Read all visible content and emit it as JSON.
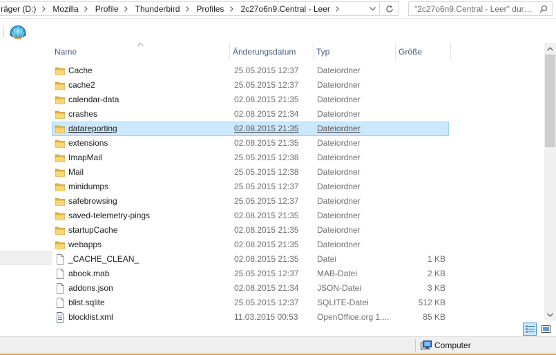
{
  "address_bar": {
    "crumbs": [
      "räger (D:)",
      "Mozilla",
      "Profile",
      "Thunderbird",
      "Profiles",
      "2c27o6n9.Central - Leer"
    ]
  },
  "search": {
    "placeholder": "\"2c27o6n9.Central - Leer\" dur…"
  },
  "columns": {
    "name": "Name",
    "date": "Änderungsdatum",
    "type": "Typ",
    "size": "Größe"
  },
  "files": [
    {
      "name": "Cache",
      "date": "25.05.2015 12:37",
      "type": "Dateiordner",
      "size": "",
      "icon": "folder-icon"
    },
    {
      "name": "cache2",
      "date": "25.05.2015 12:37",
      "type": "Dateiordner",
      "size": "",
      "icon": "folder-icon"
    },
    {
      "name": "calendar-data",
      "date": "02.08.2015 21:35",
      "type": "Dateiordner",
      "size": "",
      "icon": "folder-icon"
    },
    {
      "name": "crashes",
      "date": "02.08.2015 21:34",
      "type": "Dateiordner",
      "size": "",
      "icon": "folder-icon"
    },
    {
      "name": "datareporting",
      "date": "02.08.2015 21:35",
      "type": "Dateiordner",
      "size": "",
      "icon": "folder-icon",
      "selected": true
    },
    {
      "name": "extensions",
      "date": "02.08.2015 21:35",
      "type": "Dateiordner",
      "size": "",
      "icon": "folder-icon"
    },
    {
      "name": "ImapMail",
      "date": "25.05.2015 12:38",
      "type": "Dateiordner",
      "size": "",
      "icon": "folder-icon"
    },
    {
      "name": "Mail",
      "date": "25.05.2015 12:38",
      "type": "Dateiordner",
      "size": "",
      "icon": "folder-icon"
    },
    {
      "name": "minidumps",
      "date": "25.05.2015 12:37",
      "type": "Dateiordner",
      "size": "",
      "icon": "folder-icon"
    },
    {
      "name": "safebrowsing",
      "date": "25.05.2015 12:37",
      "type": "Dateiordner",
      "size": "",
      "icon": "folder-icon"
    },
    {
      "name": "saved-telemetry-pings",
      "date": "02.08.2015 21:35",
      "type": "Dateiordner",
      "size": "",
      "icon": "folder-icon"
    },
    {
      "name": "startupCache",
      "date": "02.08.2015 21:35",
      "type": "Dateiordner",
      "size": "",
      "icon": "folder-icon"
    },
    {
      "name": "webapps",
      "date": "02.08.2015 21:35",
      "type": "Dateiordner",
      "size": "",
      "icon": "folder-icon"
    },
    {
      "name": "_CACHE_CLEAN_",
      "date": "02.08.2015 21:35",
      "type": "Datei",
      "size": "1 KB",
      "icon": "file-icon"
    },
    {
      "name": "abook.mab",
      "date": "25.05.2015 12:37",
      "type": "MAB-Datei",
      "size": "2 KB",
      "icon": "file-icon"
    },
    {
      "name": "addons.json",
      "date": "02.08.2015 21:34",
      "type": "JSON-Datei",
      "size": "3 KB",
      "icon": "file-icon"
    },
    {
      "name": "blist.sqlite",
      "date": "25.05.2015 12:37",
      "type": "SQLITE-Datei",
      "size": "512 KB",
      "icon": "file-icon"
    },
    {
      "name": "blocklist.xml",
      "date": "11.03.2015 00:53",
      "type": "OpenOffice.org 1....",
      "size": "85 KB",
      "icon": "xml-file-icon"
    }
  ],
  "status_bar": {
    "location": "Computer"
  },
  "colors": {
    "selection_bg": "#cce8ff",
    "selection_border": "#99d1ff",
    "folder_yellow": "#f2c94c",
    "header_text": "#4c607a"
  }
}
